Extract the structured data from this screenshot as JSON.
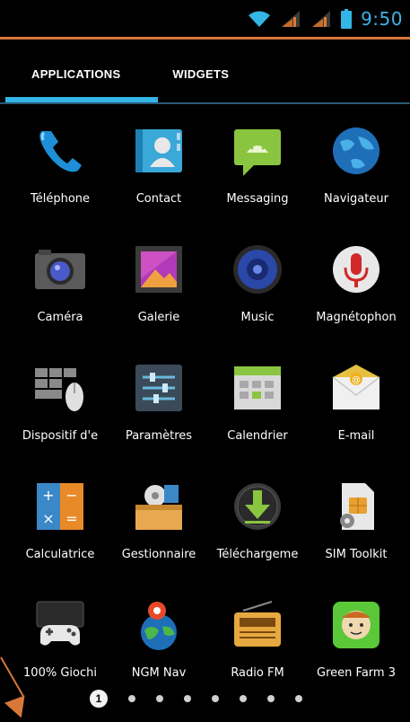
{
  "status_bar": {
    "clock": "9:50",
    "icons": [
      "wifi-icon",
      "signal-icon",
      "signal-icon",
      "battery-icon"
    ],
    "clock_color": "#3fb2e6"
  },
  "tabs": [
    {
      "label": "APPLICATIONS",
      "active": true
    },
    {
      "label": "WIDGETS",
      "active": false
    }
  ],
  "apps": [
    {
      "label": "Téléphone",
      "icon": "phone-icon"
    },
    {
      "label": "Contact",
      "icon": "contacts-icon"
    },
    {
      "label": "Messaging",
      "icon": "messaging-icon"
    },
    {
      "label": "Navigateur",
      "icon": "browser-globe-icon"
    },
    {
      "label": "Caméra",
      "icon": "camera-icon"
    },
    {
      "label": "Galerie",
      "icon": "gallery-icon"
    },
    {
      "label": "Music",
      "icon": "music-speaker-icon"
    },
    {
      "label": "Magnétophon",
      "icon": "microphone-icon"
    },
    {
      "label": "Dispositif d'e",
      "icon": "input-device-icon"
    },
    {
      "label": "Paramètres",
      "icon": "settings-sliders-icon"
    },
    {
      "label": "Calendrier",
      "icon": "calendar-icon"
    },
    {
      "label": "E-mail",
      "icon": "email-envelope-icon"
    },
    {
      "label": "Calculatrice",
      "icon": "calculator-icon"
    },
    {
      "label": "Gestionnaire",
      "icon": "file-manager-icon"
    },
    {
      "label": "Téléchargeme",
      "icon": "download-icon"
    },
    {
      "label": "SIM Toolkit",
      "icon": "sim-card-icon"
    },
    {
      "label": "100% Giochi",
      "icon": "gamepad-icon"
    },
    {
      "label": "NGM Nav",
      "icon": "nav-earth-icon"
    },
    {
      "label": "Radio FM",
      "icon": "radio-icon"
    },
    {
      "label": "Green Farm 3",
      "icon": "green-farm-icon"
    }
  ],
  "pager": {
    "current_page": "1",
    "total_pages": 8
  },
  "colors": {
    "accent": "#33b5e5",
    "annotation": "#d8773a"
  }
}
